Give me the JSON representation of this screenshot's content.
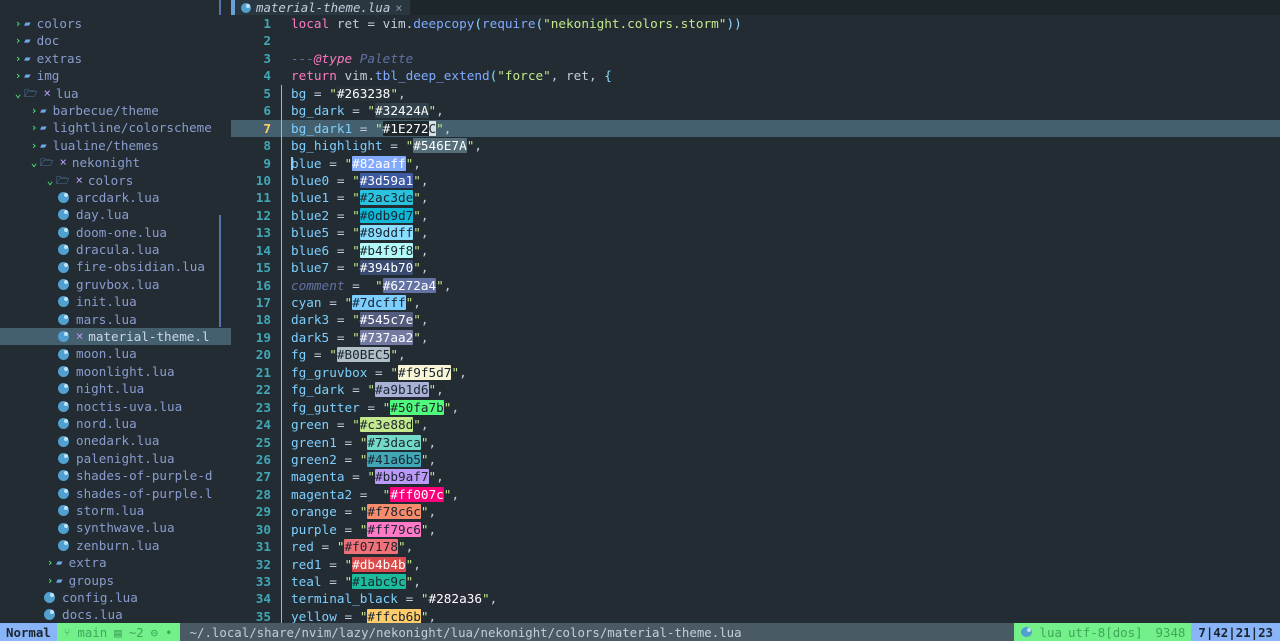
{
  "window": {
    "background": "#222c32"
  },
  "sidebar": {
    "name": "neo-tree-file-explorer",
    "items": [
      {
        "label": "colors",
        "type": "folder",
        "state": "closed",
        "indent": 1,
        "modified": false
      },
      {
        "label": "doc",
        "type": "folder",
        "state": "closed",
        "indent": 1,
        "modified": false
      },
      {
        "label": "extras",
        "type": "folder",
        "state": "closed",
        "indent": 1,
        "modified": false
      },
      {
        "label": "img",
        "type": "folder",
        "state": "closed",
        "indent": 1,
        "modified": false
      },
      {
        "label": "lua",
        "type": "folder",
        "state": "open",
        "indent": 1,
        "modified": true
      },
      {
        "label": "barbecue/theme",
        "type": "folder",
        "state": "closed",
        "indent": 2,
        "modified": false
      },
      {
        "label": "lightline/colorscheme",
        "type": "folder",
        "state": "closed",
        "indent": 2,
        "modified": false
      },
      {
        "label": "lualine/themes",
        "type": "folder",
        "state": "closed",
        "indent": 2,
        "modified": false
      },
      {
        "label": "nekonight",
        "type": "folder",
        "state": "open",
        "indent": 2,
        "modified": true
      },
      {
        "label": "colors",
        "type": "folder",
        "state": "open",
        "indent": 3,
        "modified": true
      },
      {
        "label": "arcdark.lua",
        "type": "file",
        "indent": 4,
        "modified": false
      },
      {
        "label": "day.lua",
        "type": "file",
        "indent": 4,
        "modified": false
      },
      {
        "label": "doom-one.lua",
        "type": "file",
        "indent": 4,
        "modified": false
      },
      {
        "label": "dracula.lua",
        "type": "file",
        "indent": 4,
        "modified": false
      },
      {
        "label": "fire-obsidian.lua",
        "type": "file",
        "indent": 4,
        "modified": false
      },
      {
        "label": "gruvbox.lua",
        "type": "file",
        "indent": 4,
        "modified": false
      },
      {
        "label": "init.lua",
        "type": "file",
        "indent": 4,
        "modified": false
      },
      {
        "label": "mars.lua",
        "type": "file",
        "indent": 4,
        "modified": false
      },
      {
        "label": "material-theme.l",
        "type": "file",
        "indent": 4,
        "modified": true,
        "selected": true
      },
      {
        "label": "moon.lua",
        "type": "file",
        "indent": 4,
        "modified": false
      },
      {
        "label": "moonlight.lua",
        "type": "file",
        "indent": 4,
        "modified": false
      },
      {
        "label": "night.lua",
        "type": "file",
        "indent": 4,
        "modified": false
      },
      {
        "label": "noctis-uva.lua",
        "type": "file",
        "indent": 4,
        "modified": false
      },
      {
        "label": "nord.lua",
        "type": "file",
        "indent": 4,
        "modified": false
      },
      {
        "label": "onedark.lua",
        "type": "file",
        "indent": 4,
        "modified": false
      },
      {
        "label": "palenight.lua",
        "type": "file",
        "indent": 4,
        "modified": false
      },
      {
        "label": "shades-of-purple-d",
        "type": "file",
        "indent": 4,
        "modified": false
      },
      {
        "label": "shades-of-purple.l",
        "type": "file",
        "indent": 4,
        "modified": false
      },
      {
        "label": "storm.lua",
        "type": "file",
        "indent": 4,
        "modified": false
      },
      {
        "label": "synthwave.lua",
        "type": "file",
        "indent": 4,
        "modified": false
      },
      {
        "label": "zenburn.lua",
        "type": "file",
        "indent": 4,
        "modified": false
      },
      {
        "label": "extra",
        "type": "folder",
        "state": "closed",
        "indent": 3,
        "modified": false
      },
      {
        "label": "groups",
        "type": "folder",
        "state": "closed",
        "indent": 3,
        "modified": false
      },
      {
        "label": "config.lua",
        "type": "file",
        "indent": 3,
        "modified": false
      },
      {
        "label": "docs.lua",
        "type": "file",
        "indent": 3,
        "modified": false
      }
    ]
  },
  "tabline": {
    "tabs": [
      {
        "label": "material-theme.lua",
        "icon": "lua-file-icon",
        "close": "×",
        "active": true
      }
    ]
  },
  "editor": {
    "filetype": "lua",
    "cursor": {
      "line": 7,
      "col": 42,
      "screen_col": 21,
      "virtual_col": 23
    },
    "lines": [
      {
        "n": 1,
        "tokens": [
          {
            "t": "local",
            "c": "t-kw2"
          },
          {
            "t": " ret ",
            "c": "t-plain"
          },
          {
            "t": "=",
            "c": "t-plain"
          },
          {
            "t": " vim",
            "c": "t-plain"
          },
          {
            "t": ".",
            "c": "t-plain"
          },
          {
            "t": "deepcopy",
            "c": "t-func"
          },
          {
            "t": "(",
            "c": "t-punct"
          },
          {
            "t": "require",
            "c": "t-func"
          },
          {
            "t": "(",
            "c": "t-punct"
          },
          {
            "t": "\"nekonight.colors.storm\"",
            "c": "t-str"
          },
          {
            "t": "))",
            "c": "t-punct"
          }
        ]
      },
      {
        "n": 2,
        "tokens": []
      },
      {
        "n": 3,
        "tokens": [
          {
            "t": "---",
            "c": "t-comment"
          },
          {
            "t": "@type",
            "c": "t-doc"
          },
          {
            "t": " ",
            "c": "t-plain"
          },
          {
            "t": "Palette",
            "c": "t-comment"
          }
        ]
      },
      {
        "n": 4,
        "tokens": [
          {
            "t": "return",
            "c": "t-kw2"
          },
          {
            "t": " vim",
            "c": "t-plain"
          },
          {
            "t": ".",
            "c": "t-plain"
          },
          {
            "t": "tbl_deep_extend",
            "c": "t-func"
          },
          {
            "t": "(",
            "c": "t-punct"
          },
          {
            "t": "\"force\"",
            "c": "t-str"
          },
          {
            "t": ", ret, ",
            "c": "t-plain"
          },
          {
            "t": "{",
            "c": "t-punct"
          }
        ]
      },
      {
        "n": 5,
        "guide": true,
        "key": "bg",
        "hex": "#263238",
        "hexbg": "#263238",
        "hexfg": "#ffffff",
        "pad": 2
      },
      {
        "n": 6,
        "guide": true,
        "key": "bg_dark",
        "hex": "#32424A",
        "hexbg": "#32424A",
        "hexfg": "#ffffff",
        "pad": 2
      },
      {
        "n": 7,
        "guide": true,
        "key": "bg_dark1",
        "hex": "#1E272C",
        "hexbg": "#1E272C",
        "hexfg": "#ffffff",
        "pad": 2,
        "cursorline": true,
        "cursor_on_last": true
      },
      {
        "n": 8,
        "guide": true,
        "key": "bg_highlight",
        "hex": "#546E7A",
        "hexbg": "#546E7A",
        "hexfg": "#ffffff",
        "pad": 2
      },
      {
        "n": 9,
        "guide": true,
        "key": "blue",
        "hex": "#82aaff",
        "hexbg": "#82aaff",
        "hexfg": "#ffffff",
        "pad": 2,
        "caret": true
      },
      {
        "n": 10,
        "guide": true,
        "key": "blue0",
        "hex": "#3d59a1",
        "hexbg": "#3d59a1",
        "hexfg": "#ffffff",
        "pad": 2
      },
      {
        "n": 11,
        "guide": true,
        "key": "blue1",
        "hex": "#2ac3de",
        "hexbg": "#2ac3de",
        "hexfg": "#1b2530",
        "pad": 2
      },
      {
        "n": 12,
        "guide": true,
        "key": "blue2",
        "hex": "#0db9d7",
        "hexbg": "#0db9d7",
        "hexfg": "#1b2530",
        "pad": 2
      },
      {
        "n": 13,
        "guide": true,
        "key": "blue5",
        "hex": "#89ddff",
        "hexbg": "#89ddff",
        "hexfg": "#1b2530",
        "pad": 2
      },
      {
        "n": 14,
        "guide": true,
        "key": "blue6",
        "hex": "#b4f9f8",
        "hexbg": "#b4f9f8",
        "hexfg": "#1b2530",
        "pad": 2
      },
      {
        "n": 15,
        "guide": true,
        "key": "blue7",
        "hex": "#394b70",
        "hexbg": "#394b70",
        "hexfg": "#ffffff",
        "pad": 2
      },
      {
        "n": 16,
        "guide": true,
        "key": "comment",
        "keyclass": "t-comment",
        "hex": "#6272a4",
        "hexbg": "#6272a4",
        "hexfg": "#ffffff",
        "pad": 3
      },
      {
        "n": 17,
        "guide": true,
        "key": "cyan",
        "hex": "#7dcfff",
        "hexbg": "#7dcfff",
        "hexfg": "#1b2530",
        "pad": 2
      },
      {
        "n": 18,
        "guide": true,
        "key": "dark3",
        "hex": "#545c7e",
        "hexbg": "#545c7e",
        "hexfg": "#ffffff",
        "pad": 2
      },
      {
        "n": 19,
        "guide": true,
        "key": "dark5",
        "hex": "#737aa2",
        "hexbg": "#737aa2",
        "hexfg": "#ffffff",
        "pad": 2
      },
      {
        "n": 20,
        "guide": true,
        "key": "fg",
        "hex": "#B0BEC5",
        "hexbg": "#B0BEC5",
        "hexfg": "#1b2530",
        "pad": 2
      },
      {
        "n": 21,
        "guide": true,
        "key": "fg_gruvbox",
        "hex": "#f9f5d7",
        "hexbg": "#f9f5d7",
        "hexfg": "#1b2530",
        "pad": 1
      },
      {
        "n": 22,
        "guide": true,
        "key": "fg_dark",
        "hex": "#a9b1d6",
        "hexbg": "#a9b1d6",
        "hexfg": "#1b2530",
        "pad": 2
      },
      {
        "n": 23,
        "guide": true,
        "key": "fg_gutter",
        "hex": "#50fa7b",
        "hexbg": "#50fa7b",
        "hexfg": "#1b2530",
        "pad": 2
      },
      {
        "n": 24,
        "guide": true,
        "key": "green",
        "hex": "#c3e88d",
        "hexbg": "#c3e88d",
        "hexfg": "#1b2530",
        "pad": 2
      },
      {
        "n": 25,
        "guide": true,
        "key": "green1",
        "hex": "#73daca",
        "hexbg": "#73daca",
        "hexfg": "#1b2530",
        "pad": 2
      },
      {
        "n": 26,
        "guide": true,
        "key": "green2",
        "hex": "#41a6b5",
        "hexbg": "#41a6b5",
        "hexfg": "#1b2530",
        "pad": 2
      },
      {
        "n": 27,
        "guide": true,
        "key": "magenta",
        "hex": "#bb9af7",
        "hexbg": "#bb9af7",
        "hexfg": "#1b2530",
        "pad": 2
      },
      {
        "n": 28,
        "guide": true,
        "key": "magenta2",
        "hex": "#ff007c",
        "hexbg": "#ff007c",
        "hexfg": "#ffffff",
        "pad": 3
      },
      {
        "n": 29,
        "guide": true,
        "key": "orange",
        "hex": "#f78c6c",
        "hexbg": "#f78c6c",
        "hexfg": "#1b2530",
        "pad": 2
      },
      {
        "n": 30,
        "guide": true,
        "key": "purple",
        "hex": "#ff79c6",
        "hexbg": "#ff79c6",
        "hexfg": "#1b2530",
        "pad": 2
      },
      {
        "n": 31,
        "guide": true,
        "key": "red",
        "hex": "#f07178",
        "hexbg": "#f07178",
        "hexfg": "#1b2530",
        "pad": 2
      },
      {
        "n": 32,
        "guide": true,
        "key": "red1",
        "hex": "#db4b4b",
        "hexbg": "#db4b4b",
        "hexfg": "#ffffff",
        "pad": 2
      },
      {
        "n": 33,
        "guide": true,
        "key": "teal",
        "hex": "#1abc9c",
        "hexbg": "#1abc9c",
        "hexfg": "#1b2530",
        "pad": 2
      },
      {
        "n": 34,
        "guide": true,
        "key": "terminal_black",
        "hex": "#282a36",
        "hexbg": "#282a36",
        "hexfg": "#ffffff",
        "pad": 2
      },
      {
        "n": 35,
        "guide": true,
        "key": "yellow",
        "hex": "#ffcb6b",
        "hexbg": "#ffcb6b",
        "hexfg": "#1b2530",
        "pad": 2
      }
    ]
  },
  "statusline": {
    "mode": "Normal",
    "git_branch": "main",
    "git_branch_icon": "git-branch-icon",
    "git_added_icon": "diff-added-icon",
    "git_changed": "~2",
    "git_removed_icon": "diff-removed-icon",
    "diagnostic_icon": "•",
    "path": "~/.local/share/nvim/lazy/nekonight/lua/nekonight/colors/material-theme.lua",
    "filetype": "lua",
    "encoding": "utf-8[dos]",
    "filesize": "9348",
    "position": "7|42|21|23"
  }
}
